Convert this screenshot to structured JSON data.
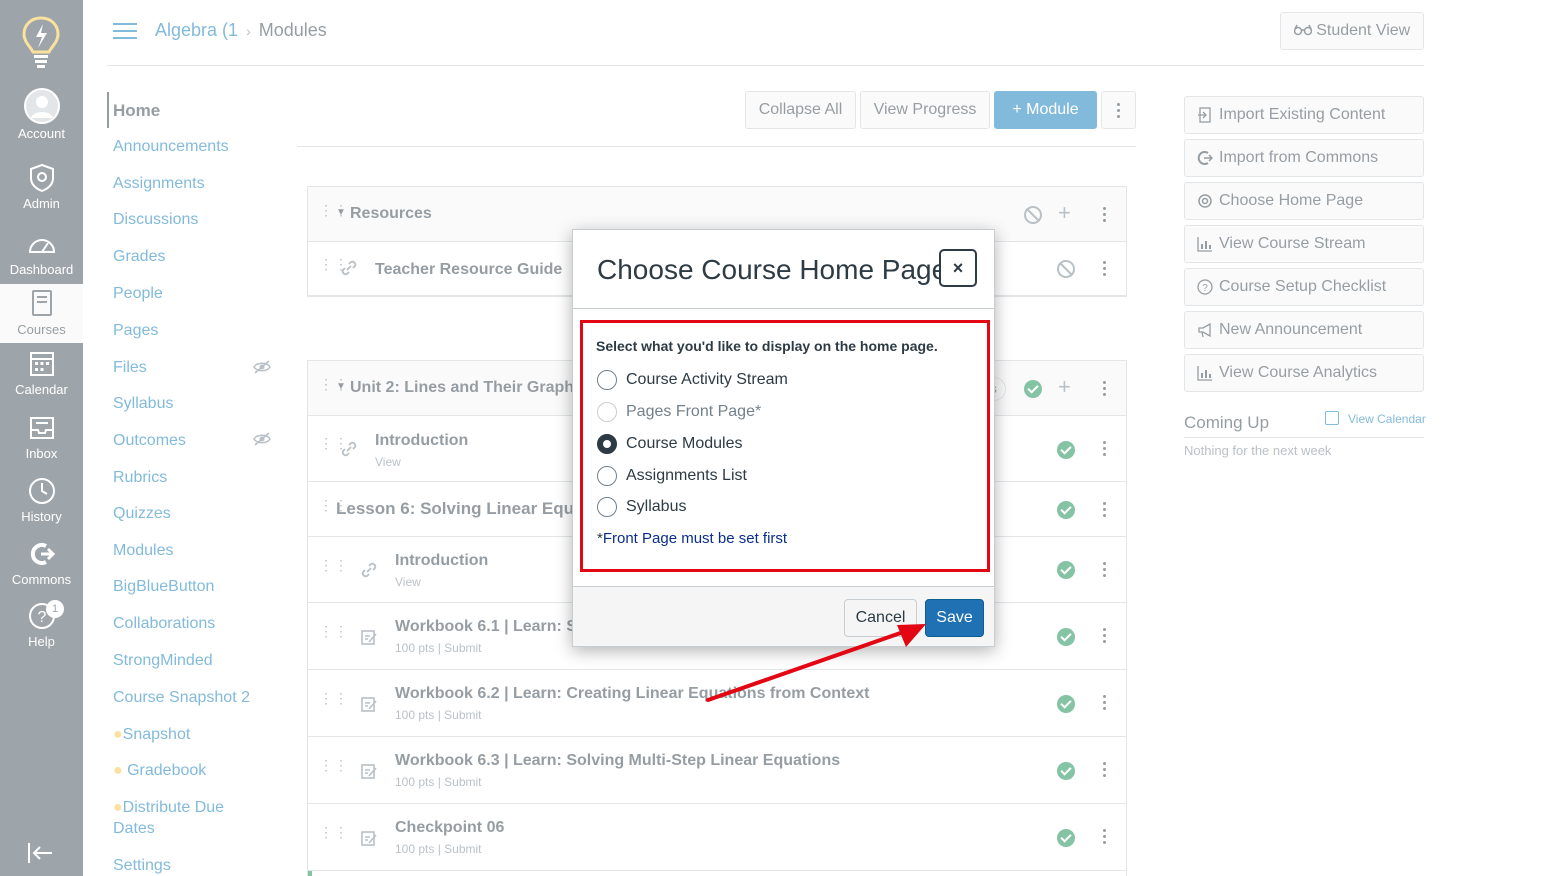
{
  "global_nav": {
    "items": [
      {
        "label": "Account",
        "icon": "avatar-icon"
      },
      {
        "label": "Admin",
        "icon": "shield-icon"
      },
      {
        "label": "Dashboard",
        "icon": "gauge-icon"
      },
      {
        "label": "Courses",
        "icon": "book-icon"
      },
      {
        "label": "Calendar",
        "icon": "calendar-icon"
      },
      {
        "label": "Inbox",
        "icon": "inbox-icon"
      },
      {
        "label": "History",
        "icon": "clock-icon"
      },
      {
        "label": "Commons",
        "icon": "commons-icon"
      },
      {
        "label": "Help",
        "icon": "help-icon"
      }
    ],
    "help_badge": "1"
  },
  "header": {
    "breadcrumb_course": "Algebra (1",
    "breadcrumb_sep": "›",
    "breadcrumb_current": "Modules",
    "student_view": "Student View"
  },
  "course_nav": {
    "items": [
      "Home",
      "Announcements",
      "Assignments",
      "Discussions",
      "Grades",
      "People",
      "Pages",
      "Files",
      "Syllabus",
      "Outcomes",
      "Rubrics",
      "Quizzes",
      "Modules",
      "BigBlueButton",
      "Collaborations",
      "StrongMinded",
      "Course Snapshot 2",
      "Snapshot",
      "Gradebook",
      "Distribute Due",
      "Dates",
      "Settings"
    ]
  },
  "toolbar": {
    "collapse_all": "Collapse All",
    "view_progress": "View Progress",
    "add_module": "+ Module"
  },
  "modules": [
    {
      "title": "Resources",
      "items": [
        {
          "title": "Teacher Resource Guide"
        }
      ]
    },
    {
      "title": "Unit 2: Lines and Their Graphs",
      "header_pill": "ns",
      "items": [
        {
          "title": "Introduction",
          "sub": "View"
        },
        {
          "title": "Lesson 6: Solving Linear Equa"
        },
        {
          "title": "Introduction",
          "sub": "View"
        },
        {
          "title": "Workbook 6.1 | Learn: So",
          "sub": "100 pts  |  Submit"
        },
        {
          "title": "Workbook 6.2 | Learn: Creating Linear Equations from Context",
          "sub": "100 pts  |  Submit"
        },
        {
          "title": "Workbook 6.3 | Learn: Solving Multi-Step Linear Equations",
          "sub": "100 pts  |  Submit"
        },
        {
          "title": "Checkpoint 06",
          "sub": "100 pts  |  Submit"
        }
      ]
    }
  ],
  "sidebar": {
    "buttons": [
      "Import Existing Content",
      "Import from Commons",
      "Choose Home Page",
      "View Course Stream",
      "Course Setup Checklist",
      "New Announcement",
      "View Course Analytics"
    ],
    "coming_up": "Coming Up",
    "view_calendar": "View Calendar",
    "nothing": "Nothing for the next week"
  },
  "modal": {
    "title": "Choose Course Home Page",
    "close": "×",
    "prompt": "Select what you'd like to display on the home page.",
    "options": [
      {
        "label": "Course Activity Stream",
        "checked": false,
        "disabled": false
      },
      {
        "label": "Pages Front Page*",
        "checked": false,
        "disabled": true
      },
      {
        "label": "Course Modules",
        "checked": true,
        "disabled": false
      },
      {
        "label": "Assignments List",
        "checked": false,
        "disabled": false
      },
      {
        "label": "Syllabus",
        "checked": false,
        "disabled": false
      }
    ],
    "note_star": "*",
    "note_link": "Front Page must be set first",
    "cancel": "Cancel",
    "save": "Save"
  },
  "colors": {
    "accent": "#0374b5",
    "nav_bg": "#3d4a55",
    "success": "#0b874b",
    "annotation_red": "#e30613",
    "save_button": "#1f71b3"
  }
}
